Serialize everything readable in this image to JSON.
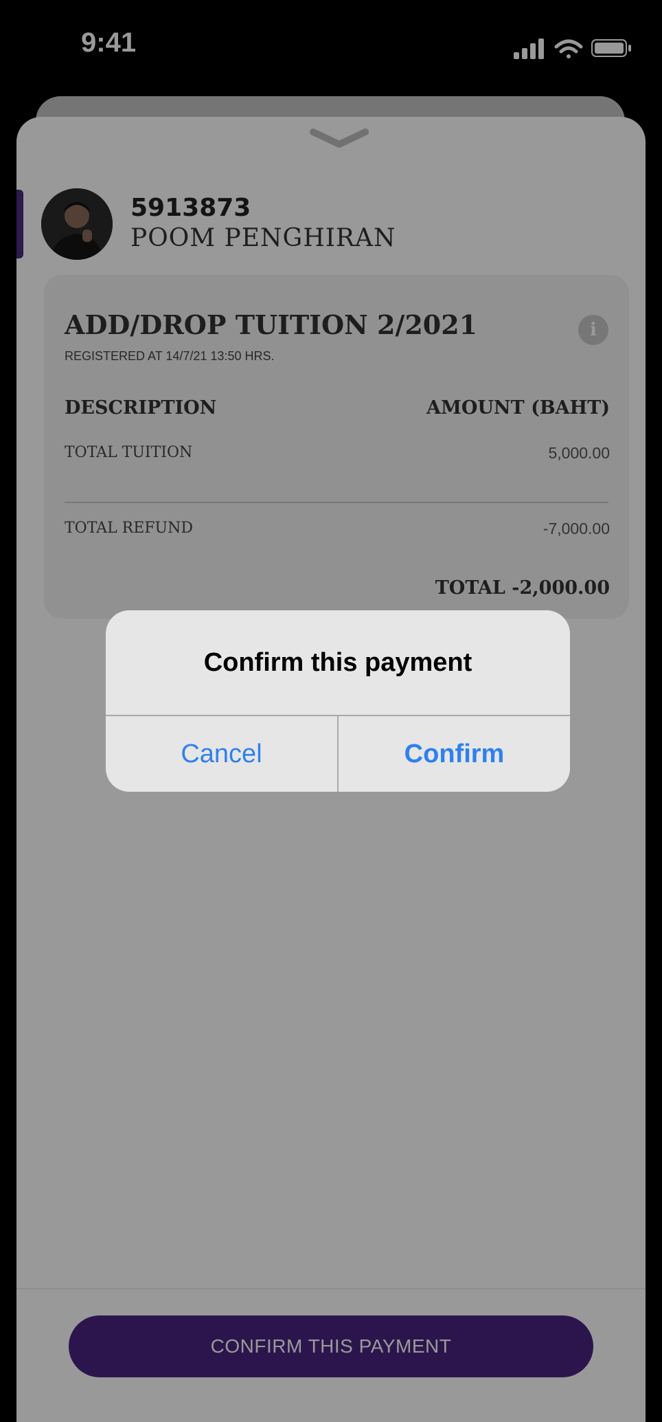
{
  "status": {
    "time": "9:41"
  },
  "student": {
    "id": "5913873",
    "name": "POOM PENGHIRAN"
  },
  "card": {
    "title": "ADD/DROP TUITION 2/2021",
    "subtitle": "REGISTERED AT 14/7/21 13:50 HRS.",
    "columns": {
      "description": "DESCRIPTION",
      "amount": "AMOUNT (BAHT)"
    },
    "rows": [
      {
        "label": "TOTAL TUITION",
        "value": "5,000.00"
      },
      {
        "label": "TOTAL REFUND",
        "value": "-7,000.00"
      }
    ],
    "total": "TOTAL -2,000.00"
  },
  "footer": {
    "button_label": "CONFIRM THIS PAYMENT"
  },
  "alert": {
    "title": "Confirm this payment",
    "cancel": "Cancel",
    "confirm": "Confirm"
  },
  "colors": {
    "accent": "#4a2380",
    "link": "#2f80ed"
  }
}
